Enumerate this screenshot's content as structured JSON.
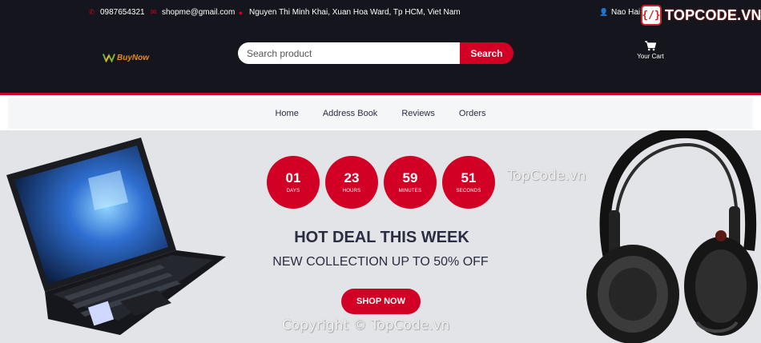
{
  "topbar": {
    "phone": "0987654321",
    "email": "shopme@gmail.com",
    "address": "Nguyen Thi Minh Khai, Xuan Hoa Ward, Tp HCM, Viet Nam",
    "user": "Nao Hai",
    "icons": {
      "phone": "phone-icon",
      "email": "envelope-icon",
      "address": "map-marker-icon",
      "user": "user-icon"
    }
  },
  "watermark": {
    "logo_badge": "{/}",
    "logo_text": "TOPCODE.VN",
    "hero_text": "TopCode.vn",
    "copyright": "Copyright © TopCode.vn"
  },
  "header": {
    "brand": "BuyNow",
    "search_placeholder": "Search product",
    "search_button": "Search",
    "cart_label": "Your Cart",
    "cart_icon": "shopping-cart-icon"
  },
  "nav": {
    "items": [
      "Home",
      "Address Book",
      "Reviews",
      "Orders"
    ]
  },
  "hero": {
    "countdown": [
      {
        "value": "01",
        "unit": "DAYS"
      },
      {
        "value": "23",
        "unit": "HOURS"
      },
      {
        "value": "59",
        "unit": "MINUTES"
      },
      {
        "value": "51",
        "unit": "SECONDS"
      }
    ],
    "title": "HOT DEAL THIS WEEK",
    "subtitle": "NEW COLLECTION UP TO 50% OFF",
    "cta": "SHOP NOW"
  },
  "colors": {
    "accent": "#d10024",
    "dark": "#15161d",
    "hero_bg": "#e3e4e8",
    "text": "#2b2d42"
  }
}
